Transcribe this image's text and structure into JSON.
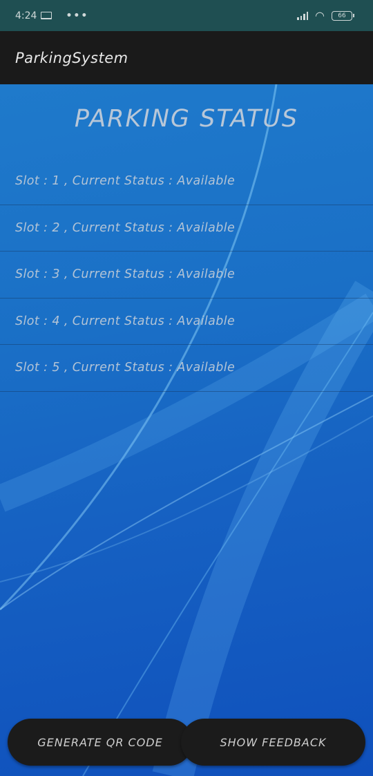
{
  "status_bar": {
    "time": "4:24",
    "more_indicator": "•••",
    "battery_level": "66",
    "icons": [
      "laptop-icon",
      "signal-icon",
      "wifi-icon",
      "battery-icon"
    ]
  },
  "app_bar": {
    "title": "ParkingSystem"
  },
  "page": {
    "title": "PARKING STATUS"
  },
  "slots": [
    {
      "label": "Slot : 1 , Current Status : Available"
    },
    {
      "label": "Slot : 2 , Current Status : Available"
    },
    {
      "label": "Slot : 3 , Current Status : Available"
    },
    {
      "label": "Slot : 4 , Current Status : Available"
    },
    {
      "label": "Slot : 5 , Current Status : Available"
    }
  ],
  "buttons": {
    "generate_qr": "GENERATE QR CODE",
    "show_feedback": "SHOW FEEDBACK"
  },
  "colors": {
    "status_bar_bg": "#1f4f52",
    "app_bar_bg": "#1a1a1a",
    "content_bg": "#1a6fc6",
    "text_muted": "#b3c4d6",
    "button_bg": "#1b1b1b"
  }
}
